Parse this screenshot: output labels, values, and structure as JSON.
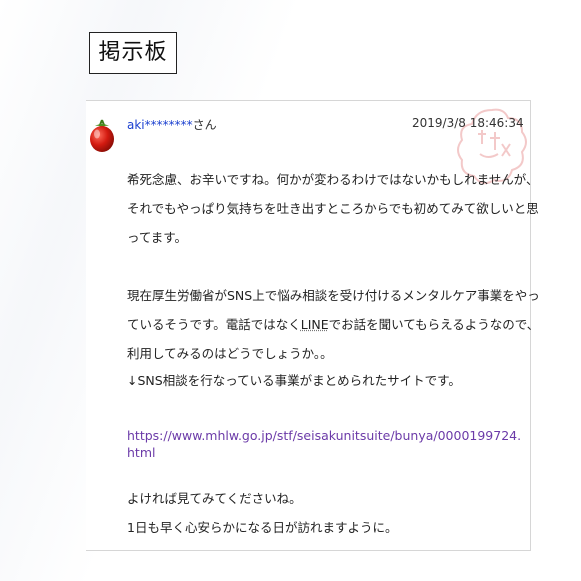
{
  "board": {
    "title": "掲示板"
  },
  "post": {
    "username": "aki********",
    "honorific": "さん",
    "timestamp": "2019/3/8  18:46:34",
    "paragraph1": [
      "希死念慮、お辛いですね。何かが変わるわけではないかもしれませんが、",
      "それでもやっぱり気持ちを吐き出すところからでも初めてみて欲しいと思",
      "ってます。"
    ],
    "paragraph2": [
      "現在厚生労働省がSNS上で悩み相談を受け付けるメンタルケア事業をやっ",
      "ているそうです。電話ではなく",
      "LINE",
      "でお話を聞いてもらえるようなので、",
      "利用してみるのはどうでしょうか。。",
      "↓SNS相談を行なっている事業がまとめられたサイトです。"
    ],
    "link": "https://www.mhlw.go.jp/stf/seisakunitsuite/bunya/0000199724.html",
    "paragraph3": [
      "よければ見てみてくださいね。",
      "1日も早く心安らかになる日が訪れますように。"
    ]
  },
  "icons": {
    "avatar": "tomato-icon",
    "stamp": "stamp-icon"
  },
  "colors": {
    "username": "#1a3fd0",
    "link": "#6b3aa8",
    "stamp": "#e58a8a"
  }
}
